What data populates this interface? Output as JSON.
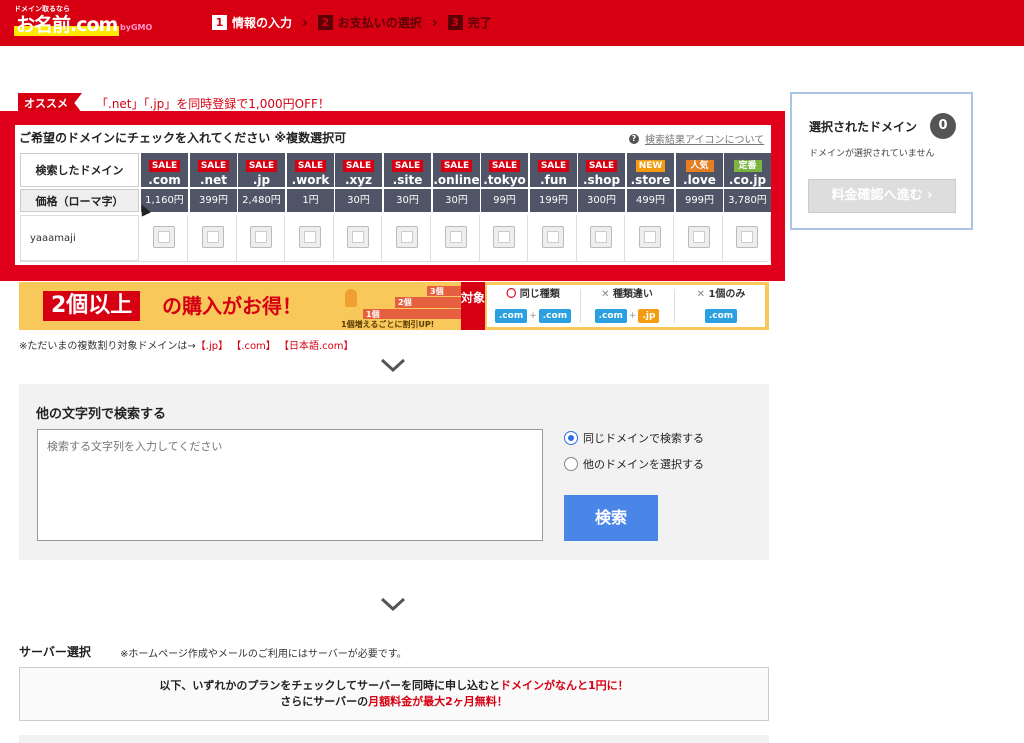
{
  "header": {
    "logo_small": "ドメイン取るなら",
    "logo_main": "お名前.com",
    "logo_gmo": "byGMO",
    "steps": [
      {
        "num": "1",
        "label": "情報の入力"
      },
      {
        "num": "2",
        "label": "お支払いの選択"
      },
      {
        "num": "3",
        "label": "完了"
      }
    ]
  },
  "promo": {
    "badge": "オススメ",
    "text": "「.net」「.jp」を同時登録で1,000円OFF！"
  },
  "table": {
    "title": "ご希望のドメインにチェックを入れてください ※複数選択可",
    "help_link": "検索結果アイコンについて",
    "row_label_searched": "検索したドメイン",
    "row_label_price": "価格（ローマ字）",
    "keyword": "yaaamaji",
    "tlds": [
      {
        "badge": "SALE",
        "badge_color": "#d60012",
        "name": ".com",
        "price": "1,160円"
      },
      {
        "badge": "SALE",
        "badge_color": "#d60012",
        "name": ".net",
        "price": "399円"
      },
      {
        "badge": "SALE",
        "badge_color": "#d60012",
        "name": ".jp",
        "price": "2,480円"
      },
      {
        "badge": "SALE",
        "badge_color": "#d60012",
        "name": ".work",
        "price": "1円"
      },
      {
        "badge": "SALE",
        "badge_color": "#d60012",
        "name": ".xyz",
        "price": "30円"
      },
      {
        "badge": "SALE",
        "badge_color": "#d60012",
        "name": ".site",
        "price": "30円"
      },
      {
        "badge": "SALE",
        "badge_color": "#d60012",
        "name": ".online",
        "price": "30円"
      },
      {
        "badge": "SALE",
        "badge_color": "#d60012",
        "name": ".tokyo",
        "price": "99円"
      },
      {
        "badge": "SALE",
        "badge_color": "#d60012",
        "name": ".fun",
        "price": "199円"
      },
      {
        "badge": "SALE",
        "badge_color": "#d60012",
        "name": ".shop",
        "price": "300円"
      },
      {
        "badge": "NEW",
        "badge_color": "#f39c12",
        "name": ".store",
        "price": "499円"
      },
      {
        "badge": "人気",
        "badge_color": "#e67e22",
        "name": ".love",
        "price": "999円"
      },
      {
        "badge": "定番",
        "badge_color": "#7cb342",
        "name": ".co.jp",
        "price": "3,780円"
      }
    ]
  },
  "sidebar": {
    "title": "選択されたドメイン",
    "count": "0",
    "empty_text": "ドメインが選択されていません",
    "button_label": "料金確認へ進む ›"
  },
  "banner": {
    "big_text": "2個以上",
    "big_text2": "の購入がお得！",
    "stairs": [
      "1個",
      "2個",
      "3個"
    ],
    "stair_note": "1個増えるごとに割引UP!",
    "target": "対象",
    "options": [
      {
        "mark": "〇",
        "title": "同じ種類",
        "left": ".com",
        "right": ".com",
        "right_color": "#2aa0e0"
      },
      {
        "mark": "✕",
        "title": "種類違い",
        "left": ".com",
        "right": ".jp",
        "right_color": "#f39c12"
      },
      {
        "mark": "✕",
        "title": "1個のみ",
        "left": ".com",
        "right": "",
        "right_color": ""
      }
    ]
  },
  "note": {
    "prefix": "※ただいまの複数割り対象ドメインは→",
    "items": [
      "【.jp】",
      "【.com】",
      "【日本語.com】"
    ]
  },
  "search": {
    "title": "他の文字列で検索する",
    "placeholder": "検索する文字列を入力してください",
    "radio_same": "同じドメインで検索する",
    "radio_other": "他のドメインを選択する",
    "button_label": "検索"
  },
  "server": {
    "label": "サーバー選択",
    "note": "※ホームページ作成やメールのご利用にはサーバーが必要です。",
    "line1_a": "以下、いずれかのプランをチェックしてサーバーを同時に申し込むと",
    "line1_b": "ドメインがなんと1円に！",
    "line2_a": "さらにサーバーの",
    "line2_b": "月額料金が最大2ヶ月無料！"
  }
}
